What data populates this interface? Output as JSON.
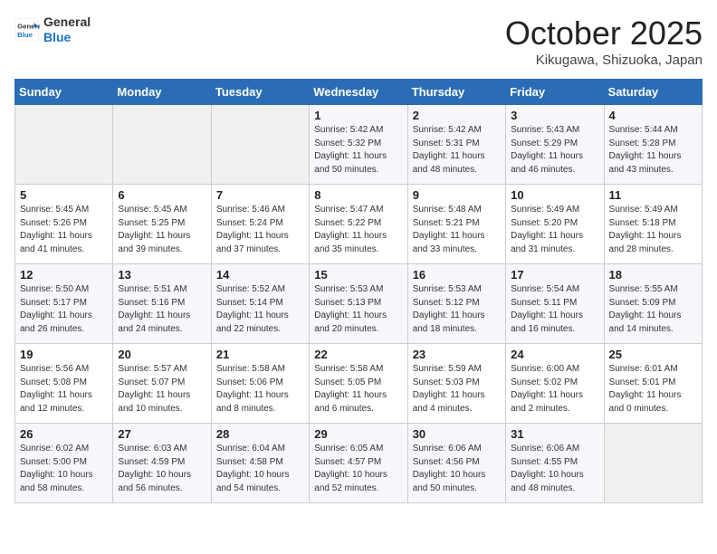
{
  "header": {
    "logo_general": "General",
    "logo_blue": "Blue",
    "month": "October 2025",
    "location": "Kikugawa, Shizuoka, Japan"
  },
  "weekdays": [
    "Sunday",
    "Monday",
    "Tuesday",
    "Wednesday",
    "Thursday",
    "Friday",
    "Saturday"
  ],
  "weeks": [
    [
      {
        "day": "",
        "info": ""
      },
      {
        "day": "",
        "info": ""
      },
      {
        "day": "",
        "info": ""
      },
      {
        "day": "1",
        "info": "Sunrise: 5:42 AM\nSunset: 5:32 PM\nDaylight: 11 hours\nand 50 minutes."
      },
      {
        "day": "2",
        "info": "Sunrise: 5:42 AM\nSunset: 5:31 PM\nDaylight: 11 hours\nand 48 minutes."
      },
      {
        "day": "3",
        "info": "Sunrise: 5:43 AM\nSunset: 5:29 PM\nDaylight: 11 hours\nand 46 minutes."
      },
      {
        "day": "4",
        "info": "Sunrise: 5:44 AM\nSunset: 5:28 PM\nDaylight: 11 hours\nand 43 minutes."
      }
    ],
    [
      {
        "day": "5",
        "info": "Sunrise: 5:45 AM\nSunset: 5:26 PM\nDaylight: 11 hours\nand 41 minutes."
      },
      {
        "day": "6",
        "info": "Sunrise: 5:45 AM\nSunset: 5:25 PM\nDaylight: 11 hours\nand 39 minutes."
      },
      {
        "day": "7",
        "info": "Sunrise: 5:46 AM\nSunset: 5:24 PM\nDaylight: 11 hours\nand 37 minutes."
      },
      {
        "day": "8",
        "info": "Sunrise: 5:47 AM\nSunset: 5:22 PM\nDaylight: 11 hours\nand 35 minutes."
      },
      {
        "day": "9",
        "info": "Sunrise: 5:48 AM\nSunset: 5:21 PM\nDaylight: 11 hours\nand 33 minutes."
      },
      {
        "day": "10",
        "info": "Sunrise: 5:49 AM\nSunset: 5:20 PM\nDaylight: 11 hours\nand 31 minutes."
      },
      {
        "day": "11",
        "info": "Sunrise: 5:49 AM\nSunset: 5:18 PM\nDaylight: 11 hours\nand 28 minutes."
      }
    ],
    [
      {
        "day": "12",
        "info": "Sunrise: 5:50 AM\nSunset: 5:17 PM\nDaylight: 11 hours\nand 26 minutes."
      },
      {
        "day": "13",
        "info": "Sunrise: 5:51 AM\nSunset: 5:16 PM\nDaylight: 11 hours\nand 24 minutes."
      },
      {
        "day": "14",
        "info": "Sunrise: 5:52 AM\nSunset: 5:14 PM\nDaylight: 11 hours\nand 22 minutes."
      },
      {
        "day": "15",
        "info": "Sunrise: 5:53 AM\nSunset: 5:13 PM\nDaylight: 11 hours\nand 20 minutes."
      },
      {
        "day": "16",
        "info": "Sunrise: 5:53 AM\nSunset: 5:12 PM\nDaylight: 11 hours\nand 18 minutes."
      },
      {
        "day": "17",
        "info": "Sunrise: 5:54 AM\nSunset: 5:11 PM\nDaylight: 11 hours\nand 16 minutes."
      },
      {
        "day": "18",
        "info": "Sunrise: 5:55 AM\nSunset: 5:09 PM\nDaylight: 11 hours\nand 14 minutes."
      }
    ],
    [
      {
        "day": "19",
        "info": "Sunrise: 5:56 AM\nSunset: 5:08 PM\nDaylight: 11 hours\nand 12 minutes."
      },
      {
        "day": "20",
        "info": "Sunrise: 5:57 AM\nSunset: 5:07 PM\nDaylight: 11 hours\nand 10 minutes."
      },
      {
        "day": "21",
        "info": "Sunrise: 5:58 AM\nSunset: 5:06 PM\nDaylight: 11 hours\nand 8 minutes."
      },
      {
        "day": "22",
        "info": "Sunrise: 5:58 AM\nSunset: 5:05 PM\nDaylight: 11 hours\nand 6 minutes."
      },
      {
        "day": "23",
        "info": "Sunrise: 5:59 AM\nSunset: 5:03 PM\nDaylight: 11 hours\nand 4 minutes."
      },
      {
        "day": "24",
        "info": "Sunrise: 6:00 AM\nSunset: 5:02 PM\nDaylight: 11 hours\nand 2 minutes."
      },
      {
        "day": "25",
        "info": "Sunrise: 6:01 AM\nSunset: 5:01 PM\nDaylight: 11 hours\nand 0 minutes."
      }
    ],
    [
      {
        "day": "26",
        "info": "Sunrise: 6:02 AM\nSunset: 5:00 PM\nDaylight: 10 hours\nand 58 minutes."
      },
      {
        "day": "27",
        "info": "Sunrise: 6:03 AM\nSunset: 4:59 PM\nDaylight: 10 hours\nand 56 minutes."
      },
      {
        "day": "28",
        "info": "Sunrise: 6:04 AM\nSunset: 4:58 PM\nDaylight: 10 hours\nand 54 minutes."
      },
      {
        "day": "29",
        "info": "Sunrise: 6:05 AM\nSunset: 4:57 PM\nDaylight: 10 hours\nand 52 minutes."
      },
      {
        "day": "30",
        "info": "Sunrise: 6:06 AM\nSunset: 4:56 PM\nDaylight: 10 hours\nand 50 minutes."
      },
      {
        "day": "31",
        "info": "Sunrise: 6:06 AM\nSunset: 4:55 PM\nDaylight: 10 hours\nand 48 minutes."
      },
      {
        "day": "",
        "info": ""
      }
    ]
  ]
}
